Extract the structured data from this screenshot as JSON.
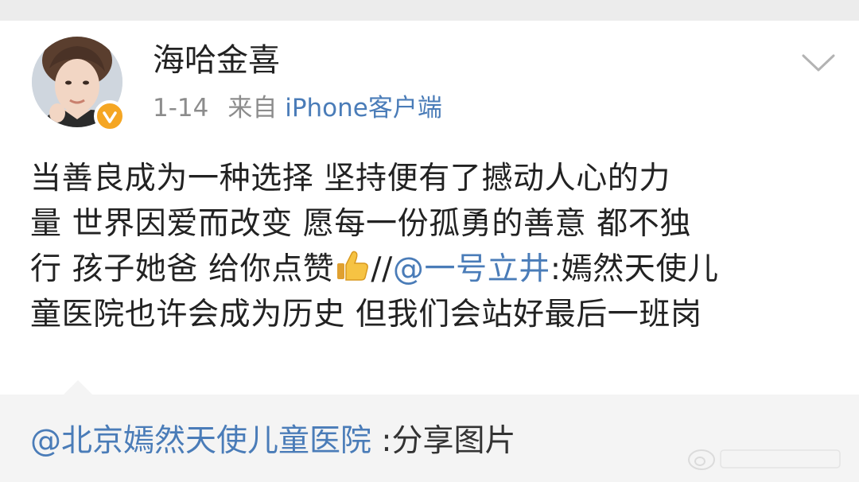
{
  "post": {
    "author": "海哈金喜",
    "date": "1-14",
    "source_prefix": "来自",
    "source": "iPhone客户端",
    "body": {
      "line1": "当善良成为一种选择 坚持便有了撼动人心的力",
      "line2": "量 世界因爱而改变 愿每一份孤勇的善意 都不独",
      "line3_text": "行 孩子她爸 给你点赞",
      "line3_slashes": "//",
      "line3_mention": "@一号立井",
      "line3_tail": ":嫣然天使儿",
      "line4": "童医院也许会成为历史 但我们会站好最后一班岗"
    }
  },
  "retweet": {
    "mention": "@北京嫣然天使儿童医院",
    "suffix": " :分享图片"
  },
  "icons": {
    "verified": "verified-badge-icon",
    "dropdown": "chevron-down-icon",
    "thumbs_up": "thumbs-up-emoji",
    "watermark": "weibo-watermark-icon"
  },
  "colors": {
    "link": "#4a7cb8",
    "verified": "#f5a623",
    "meta": "#8c8c8c",
    "retweet_bg": "#f4f4f4"
  }
}
